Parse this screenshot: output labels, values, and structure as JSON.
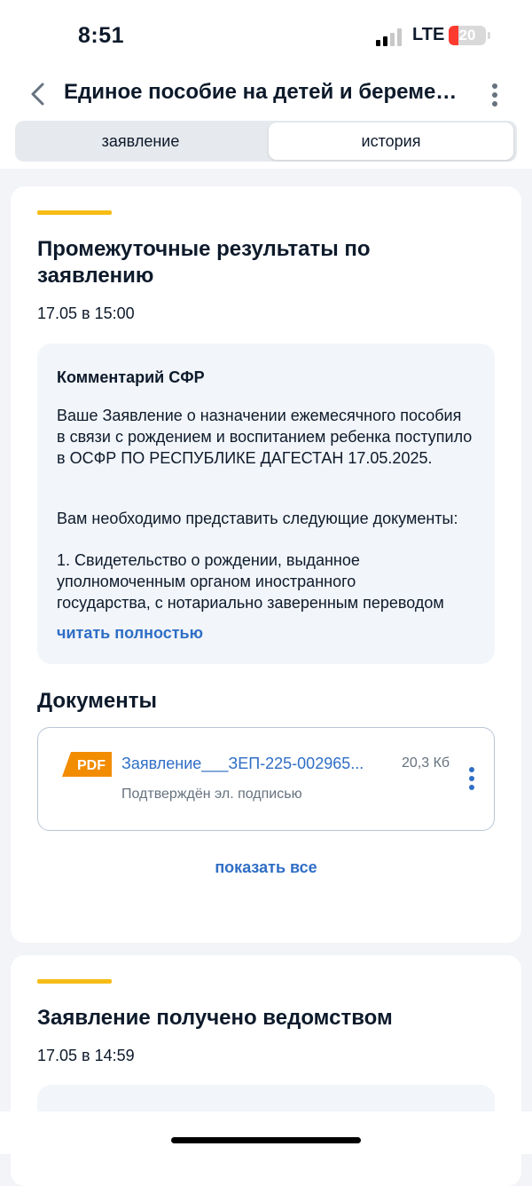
{
  "status": {
    "time": "8:51",
    "network": "LTE",
    "battery": "20"
  },
  "header": {
    "title": "Единое пособие на детей и беременных"
  },
  "tabs": [
    {
      "label": "заявление"
    },
    {
      "label": "история"
    }
  ],
  "events": [
    {
      "title": "Промежуточные результаты по заявлению",
      "date": "17.05 в 15:00",
      "comment": {
        "heading": "Комментарий СФР",
        "p1": "Ваше Заявление о назначении ежемесячного пособия в связи с рождением и воспитанием ребенка поступило в ОСФР ПО РЕСПУБЛИКЕ ДАГЕСТАН 17.05.2025.",
        "p2": "Вам необходимо представить следующие документы:",
        "p3": "1. Свидетельство о рождении, выданное уполномоченным органом иностранного",
        "p4": "государства, с нотариально заверенным переводом",
        "read_more": "читать полностью"
      },
      "documents_title": "Документы",
      "document": {
        "badge": "PDF",
        "name": "Заявление___ЗЕП-225-002965...",
        "size": "20,3 Кб",
        "signature": "Подтверждён эл. подписью"
      },
      "show_all": "показать все"
    },
    {
      "title": "Заявление получено ведомством",
      "date": "17.05 в 14:59"
    }
  ],
  "colors": {
    "accent": "#f7bd17",
    "link": "#2f6ec6",
    "pdf_badge": "#f28c00"
  }
}
